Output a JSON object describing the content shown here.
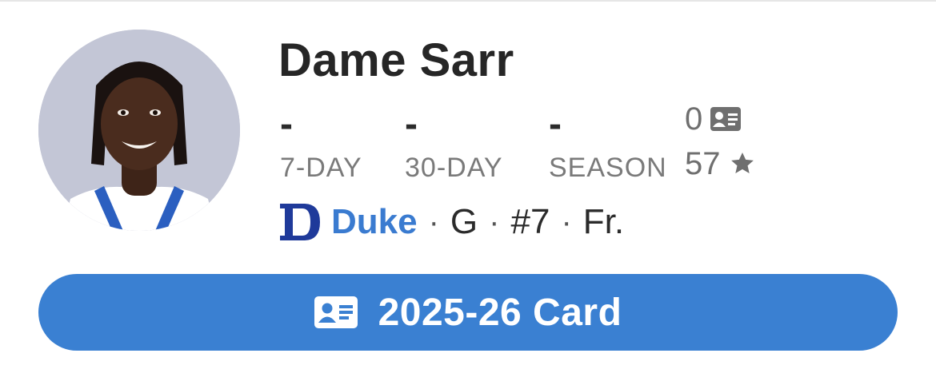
{
  "player": {
    "name": "Dame Sarr",
    "avatar_icon": "player-headshot"
  },
  "stats": [
    {
      "value": "-",
      "label": "7-DAY"
    },
    {
      "value": "-",
      "label": "30-DAY"
    },
    {
      "value": "-",
      "label": "SEASON"
    }
  ],
  "counts": {
    "cards": "0",
    "cards_icon": "id-card-icon",
    "stars": "57",
    "stars_icon": "star-icon"
  },
  "team": {
    "name": "Duke",
    "logo_icon": "duke-d-logo",
    "position": "G",
    "number": "#7",
    "class_year": "Fr.",
    "separator": "·"
  },
  "card_button": {
    "label": "2025-26 Card",
    "icon": "id-card-icon"
  },
  "colors": {
    "accent": "#3a80d2",
    "team_blue": "#3a7bd0",
    "duke_logo": "#1f3a9a",
    "avatar_bg": "#c3c6d6"
  }
}
